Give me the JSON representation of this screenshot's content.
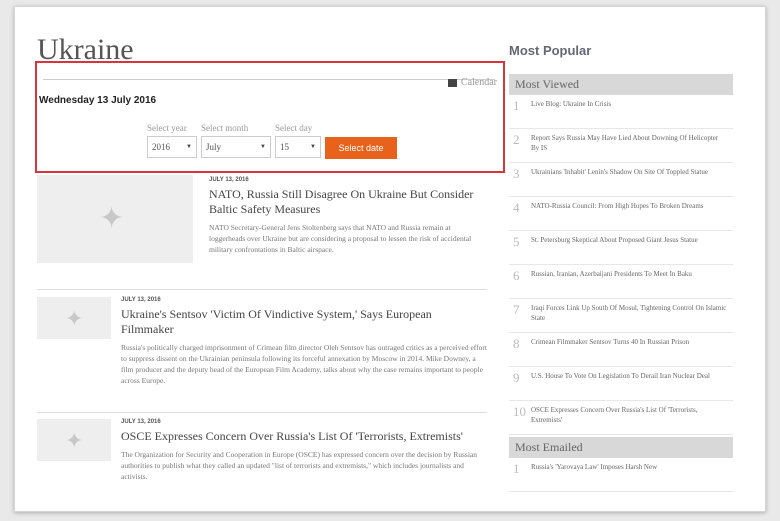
{
  "page": {
    "title": "Ukraine"
  },
  "calendar": {
    "link_label": "Calendar",
    "date_label": "Wednesday 13 July 2016",
    "year": {
      "caption": "Select year",
      "value": "2016"
    },
    "month": {
      "caption": "Select month",
      "value": "July"
    },
    "day": {
      "caption": "Select day",
      "value": "15"
    },
    "button_label": "Select date"
  },
  "articles": [
    {
      "date": "JULY 13, 2016",
      "headline": "NATO, Russia Still Disagree On Ukraine But Consider Baltic Safety Measures",
      "body": "NATO Secretary-General Jens Stoltenberg says that NATO and Russia remain at loggerheads over Ukraine but are considering a proposal to lessen the risk of accidental military confrontations in Baltic airspace."
    },
    {
      "date": "JULY 13, 2016",
      "headline": "Ukraine's Sentsov 'Victim Of Vindictive System,' Says European Filmmaker",
      "body": "Russia's politically charged imprisonment of Crimean film director Oleh Sentsov has outraged critics as a perceived effort to suppress dissent on the Ukrainian peninsula following its forceful annexation by Moscow in 2014. Mike Downey, a film producer and the deputy head of the European Film Academy, talks about why the case remains important to people across Europe."
    },
    {
      "date": "JULY 13, 2016",
      "headline": "OSCE Expresses Concern Over Russia's List Of 'Terrorists, Extremists'",
      "body": "The Organization for Security and Cooperation in Europe (OSCE) has expressed concern over the decision by Russian authorities to publish what they called an updated \"list of terrorists and extremists,\" which includes journalists and activists."
    }
  ],
  "sidebar": {
    "heading": "Most Popular",
    "most_viewed_label": "Most Viewed",
    "most_viewed": [
      {
        "num": "1",
        "text": "Live Blog: Ukraine In Crisis"
      },
      {
        "num": "2",
        "text": "Report Says Russia May Have Lied About Downing Of Helicopter By IS"
      },
      {
        "num": "3",
        "text": "Ukrainians 'Inhabit' Lenin's Shadow On Site Of Toppled Statue"
      },
      {
        "num": "4",
        "text": "NATO-Russia Council: From High Hopes To Broken Dreams"
      },
      {
        "num": "5",
        "text": "St. Petersburg Skeptical About Proposed Giant Jesus Statue"
      },
      {
        "num": "6",
        "text": "Russian, Iranian, Azerbaijani Presidents To Meet In Baku"
      },
      {
        "num": "7",
        "text": "Iraqi Forces Link Up South Of Mosul, Tightening Control On Islamic State"
      },
      {
        "num": "8",
        "text": "Crimean Filmmaker Sentsov Turns 40 In Russian Prison"
      },
      {
        "num": "9",
        "text": "U.S. House To Vote On Legislation To Derail Iran Nuclear Deal"
      },
      {
        "num": "10",
        "text": "OSCE Expresses Concern Over Russia's List Of 'Terrorists, Extremists'"
      }
    ],
    "most_emailed_label": "Most Emailed",
    "most_emailed": [
      {
        "num": "1",
        "text": "Russia's 'Yarovaya Law' Imposes Harsh New"
      }
    ]
  }
}
